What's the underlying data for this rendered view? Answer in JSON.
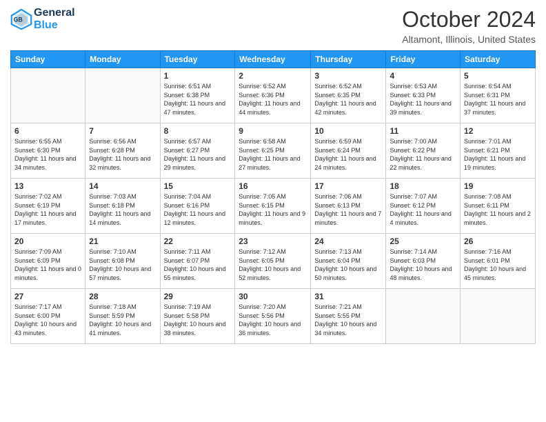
{
  "header": {
    "logo_line1": "General",
    "logo_line2": "Blue",
    "month_title": "October 2024",
    "location": "Altamont, Illinois, United States"
  },
  "days_of_week": [
    "Sunday",
    "Monday",
    "Tuesday",
    "Wednesday",
    "Thursday",
    "Friday",
    "Saturday"
  ],
  "weeks": [
    [
      {
        "day": "",
        "empty": true
      },
      {
        "day": "",
        "empty": true
      },
      {
        "day": "1",
        "sunrise": "6:51 AM",
        "sunset": "6:38 PM",
        "daylight": "11 hours and 47 minutes."
      },
      {
        "day": "2",
        "sunrise": "6:52 AM",
        "sunset": "6:36 PM",
        "daylight": "11 hours and 44 minutes."
      },
      {
        "day": "3",
        "sunrise": "6:52 AM",
        "sunset": "6:35 PM",
        "daylight": "11 hours and 42 minutes."
      },
      {
        "day": "4",
        "sunrise": "6:53 AM",
        "sunset": "6:33 PM",
        "daylight": "11 hours and 39 minutes."
      },
      {
        "day": "5",
        "sunrise": "6:54 AM",
        "sunset": "6:31 PM",
        "daylight": "11 hours and 37 minutes."
      }
    ],
    [
      {
        "day": "6",
        "sunrise": "6:55 AM",
        "sunset": "6:30 PM",
        "daylight": "11 hours and 34 minutes."
      },
      {
        "day": "7",
        "sunrise": "6:56 AM",
        "sunset": "6:28 PM",
        "daylight": "11 hours and 32 minutes."
      },
      {
        "day": "8",
        "sunrise": "6:57 AM",
        "sunset": "6:27 PM",
        "daylight": "11 hours and 29 minutes."
      },
      {
        "day": "9",
        "sunrise": "6:58 AM",
        "sunset": "6:25 PM",
        "daylight": "11 hours and 27 minutes."
      },
      {
        "day": "10",
        "sunrise": "6:59 AM",
        "sunset": "6:24 PM",
        "daylight": "11 hours and 24 minutes."
      },
      {
        "day": "11",
        "sunrise": "7:00 AM",
        "sunset": "6:22 PM",
        "daylight": "11 hours and 22 minutes."
      },
      {
        "day": "12",
        "sunrise": "7:01 AM",
        "sunset": "6:21 PM",
        "daylight": "11 hours and 19 minutes."
      }
    ],
    [
      {
        "day": "13",
        "sunrise": "7:02 AM",
        "sunset": "6:19 PM",
        "daylight": "11 hours and 17 minutes."
      },
      {
        "day": "14",
        "sunrise": "7:03 AM",
        "sunset": "6:18 PM",
        "daylight": "11 hours and 14 minutes."
      },
      {
        "day": "15",
        "sunrise": "7:04 AM",
        "sunset": "6:16 PM",
        "daylight": "11 hours and 12 minutes."
      },
      {
        "day": "16",
        "sunrise": "7:05 AM",
        "sunset": "6:15 PM",
        "daylight": "11 hours and 9 minutes."
      },
      {
        "day": "17",
        "sunrise": "7:06 AM",
        "sunset": "6:13 PM",
        "daylight": "11 hours and 7 minutes."
      },
      {
        "day": "18",
        "sunrise": "7:07 AM",
        "sunset": "6:12 PM",
        "daylight": "11 hours and 4 minutes."
      },
      {
        "day": "19",
        "sunrise": "7:08 AM",
        "sunset": "6:11 PM",
        "daylight": "11 hours and 2 minutes."
      }
    ],
    [
      {
        "day": "20",
        "sunrise": "7:09 AM",
        "sunset": "6:09 PM",
        "daylight": "11 hours and 0 minutes."
      },
      {
        "day": "21",
        "sunrise": "7:10 AM",
        "sunset": "6:08 PM",
        "daylight": "10 hours and 57 minutes."
      },
      {
        "day": "22",
        "sunrise": "7:11 AM",
        "sunset": "6:07 PM",
        "daylight": "10 hours and 55 minutes."
      },
      {
        "day": "23",
        "sunrise": "7:12 AM",
        "sunset": "6:05 PM",
        "daylight": "10 hours and 52 minutes."
      },
      {
        "day": "24",
        "sunrise": "7:13 AM",
        "sunset": "6:04 PM",
        "daylight": "10 hours and 50 minutes."
      },
      {
        "day": "25",
        "sunrise": "7:14 AM",
        "sunset": "6:03 PM",
        "daylight": "10 hours and 48 minutes."
      },
      {
        "day": "26",
        "sunrise": "7:16 AM",
        "sunset": "6:01 PM",
        "daylight": "10 hours and 45 minutes."
      }
    ],
    [
      {
        "day": "27",
        "sunrise": "7:17 AM",
        "sunset": "6:00 PM",
        "daylight": "10 hours and 43 minutes."
      },
      {
        "day": "28",
        "sunrise": "7:18 AM",
        "sunset": "5:59 PM",
        "daylight": "10 hours and 41 minutes."
      },
      {
        "day": "29",
        "sunrise": "7:19 AM",
        "sunset": "5:58 PM",
        "daylight": "10 hours and 38 minutes."
      },
      {
        "day": "30",
        "sunrise": "7:20 AM",
        "sunset": "5:56 PM",
        "daylight": "10 hours and 36 minutes."
      },
      {
        "day": "31",
        "sunrise": "7:21 AM",
        "sunset": "5:55 PM",
        "daylight": "10 hours and 34 minutes."
      },
      {
        "day": "",
        "empty": true
      },
      {
        "day": "",
        "empty": true
      }
    ]
  ],
  "labels": {
    "sunrise": "Sunrise:",
    "sunset": "Sunset:",
    "daylight": "Daylight:"
  }
}
